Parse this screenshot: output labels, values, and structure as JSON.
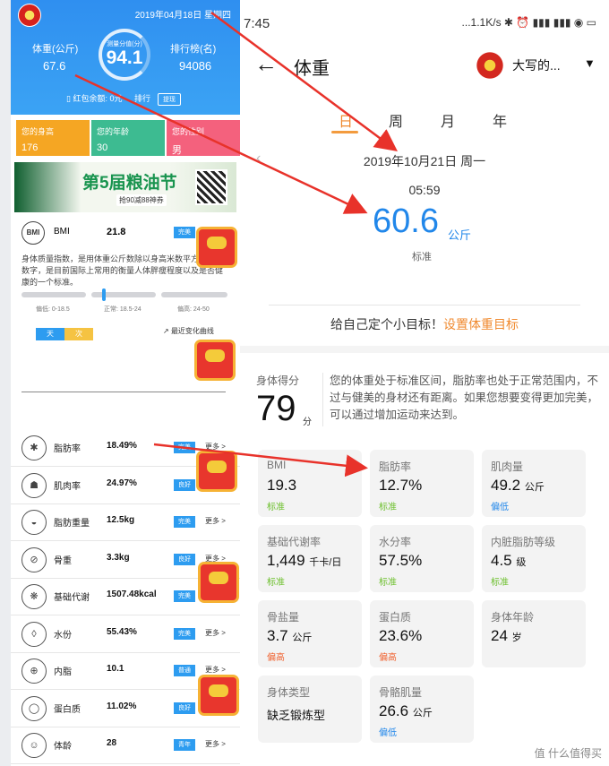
{
  "left": {
    "date": "2019年04月18日 星期四",
    "weight_label": "体重(公斤)",
    "weight_value": "67.6",
    "score_label": "测量分值(分)",
    "score_value": "94.1",
    "rank_label": "排行榜(名)",
    "rank_value": "94086",
    "wallet": "红包余额: 0元",
    "rank_link": "排行",
    "withdraw": "提现",
    "tiles": [
      {
        "label": "您的身高",
        "value": "176",
        "color": "#f5a623"
      },
      {
        "label": "您的年龄",
        "value": "30",
        "color": "#3dbb91"
      },
      {
        "label": "您的性别",
        "value": "男",
        "color": "#f4617d"
      }
    ],
    "banner": {
      "title": "第5届粮油节",
      "sub": "抢90减88神券"
    },
    "bmi": {
      "icon": "BMI",
      "name": "BMI",
      "value": "21.8",
      "badge": "完美"
    },
    "bmi_desc": "身体质量指数，是用体重公斤数除以身高米数平方得出的数字，是目前国际上常用的衡量人体胖瘦程度以及是否健康的一个标准。",
    "bmi_scale": [
      "偏低: 0-18.5",
      "正常: 18.5-24",
      "偏高: 24-50"
    ],
    "period_tabs": [
      "天",
      "次"
    ],
    "trend": "最近变化曲线",
    "metrics": [
      {
        "icon": "✱",
        "name": "脂肪率",
        "value": "18.49%",
        "badge": "完美",
        "badge_color": "#2d9cf0",
        "more": "更多 >"
      },
      {
        "icon": "☗",
        "name": "肌肉率",
        "value": "24.97%",
        "badge": "良好",
        "badge_color": "#2d9cf0",
        "more": "更多 >"
      },
      {
        "icon": "◒",
        "name": "脂肪重量",
        "value": "12.5kg",
        "badge": "完美",
        "badge_color": "#2d9cf0",
        "more": "更多 >"
      },
      {
        "icon": "⊘",
        "name": "骨重",
        "value": "3.3kg",
        "badge": "良好",
        "badge_color": "#2d9cf0",
        "more": "更多 >"
      },
      {
        "icon": "❋",
        "name": "基础代谢",
        "value": "1507.48kcal",
        "badge": "完美",
        "badge_color": "#2d9cf0",
        "more": "更多 >"
      },
      {
        "icon": "◊",
        "name": "水份",
        "value": "55.43%",
        "badge": "完美",
        "badge_color": "#2d9cf0",
        "more": "更多 >"
      },
      {
        "icon": "⊕",
        "name": "内脂",
        "value": "10.1",
        "badge": "普通",
        "badge_color": "#2d9cf0",
        "more": "更多 >"
      },
      {
        "icon": "◯",
        "name": "蛋白质",
        "value": "11.02%",
        "badge": "良好",
        "badge_color": "#2d9cf0",
        "more": "更多 >"
      },
      {
        "icon": "☺",
        "name": "体龄",
        "value": "28",
        "badge": "青年",
        "badge_color": "#2d9cf0",
        "more": "更多 >"
      }
    ]
  },
  "right": {
    "status_time": "7:45",
    "status_right": "...1.1K/s ✱ ⏰ ▮▮▮ ▮▮▮ ◉ ▭",
    "title": "体重",
    "user_name": "大写的...",
    "tabs": [
      "日",
      "周",
      "月",
      "年"
    ],
    "date": "2019年10月21日 周一",
    "time": "05:59",
    "weight_value": "60.6",
    "weight_unit": "公斤",
    "weight_status": "标准",
    "goal_text": "给自己定个小目标！",
    "goal_link": "设置体重目标",
    "score_label": "身体得分",
    "score_value": "79",
    "score_unit": "分",
    "score_desc": "您的体重处于标准区间，脂肪率也处于正常范围内，不过与健美的身材还有距离。如果您想要变得更加完美，可以通过增加运动来达到。",
    "cards": [
      {
        "label": "BMI",
        "value": "19.3",
        "unit": "",
        "status": "标准",
        "status_color": "#6bbf2a"
      },
      {
        "label": "脂肪率",
        "value": "12.7%",
        "unit": "",
        "status": "标准",
        "status_color": "#6bbf2a"
      },
      {
        "label": "肌肉量",
        "value": "49.2",
        "unit": "公斤",
        "status": "偏低",
        "status_color": "#2187ea"
      },
      {
        "label": "基础代谢率",
        "value": "1,449",
        "unit": "千卡/日",
        "status": "标准",
        "status_color": "#6bbf2a"
      },
      {
        "label": "水分率",
        "value": "57.5%",
        "unit": "",
        "status": "标准",
        "status_color": "#6bbf2a"
      },
      {
        "label": "内脏脂肪等级",
        "value": "4.5",
        "unit": "级",
        "status": "标准",
        "status_color": "#6bbf2a"
      },
      {
        "label": "骨盐量",
        "value": "3.7",
        "unit": "公斤",
        "status": "偏高",
        "status_color": "#f0622f"
      },
      {
        "label": "蛋白质",
        "value": "23.6%",
        "unit": "",
        "status": "偏高",
        "status_color": "#f0622f"
      },
      {
        "label": "身体年龄",
        "value": "24",
        "unit": "岁",
        "status": "",
        "status_color": "#6bbf2a"
      },
      {
        "label": "身体类型",
        "value": "缺乏锻炼型",
        "unit": "",
        "status": "",
        "status_color": "#6bbf2a"
      },
      {
        "label": "骨骼肌量",
        "value": "26.6",
        "unit": "公斤",
        "status": "偏低",
        "status_color": "#2187ea"
      }
    ],
    "watermark": "值 什么值得买"
  },
  "colors": {
    "accent_blue": "#2187ea",
    "orange": "#f08a2f",
    "arrow_red": "#e8322a"
  }
}
